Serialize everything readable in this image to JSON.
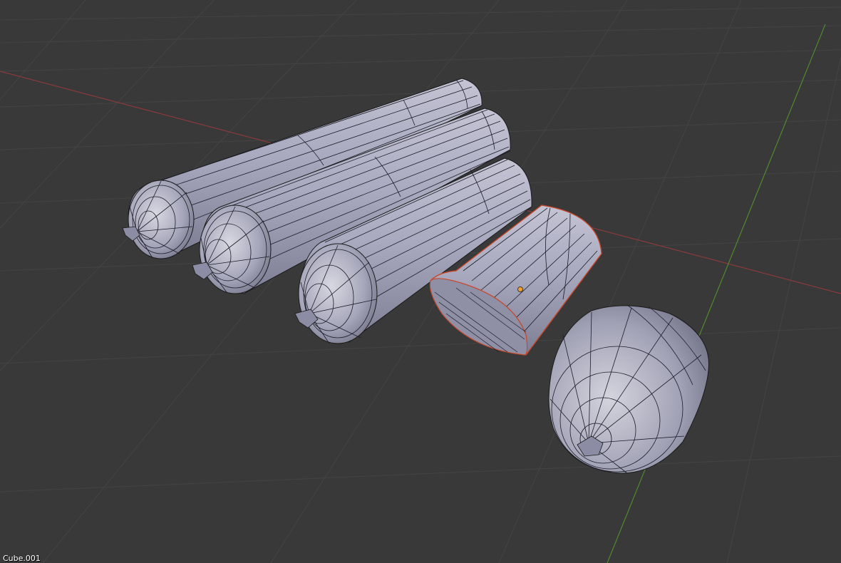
{
  "viewport": {
    "active_object_name": "Cube.001"
  },
  "scene": {
    "objects": [
      {
        "kind": "sausage",
        "selected": false
      },
      {
        "kind": "sausage",
        "selected": false
      },
      {
        "kind": "sausage",
        "selected": false
      },
      {
        "kind": "sausage-cut",
        "selected": true
      },
      {
        "kind": "sausage-short",
        "selected": false
      }
    ]
  },
  "colors": {
    "background": "#393939",
    "grid": "#444444",
    "x_axis": "#8a3a3a",
    "y_axis": "#4f8a2e",
    "mesh": "#a9a9bd",
    "wire": "#1a1a1a",
    "selection_outline": "#c8472a",
    "origin_dot": "#f0a030"
  }
}
